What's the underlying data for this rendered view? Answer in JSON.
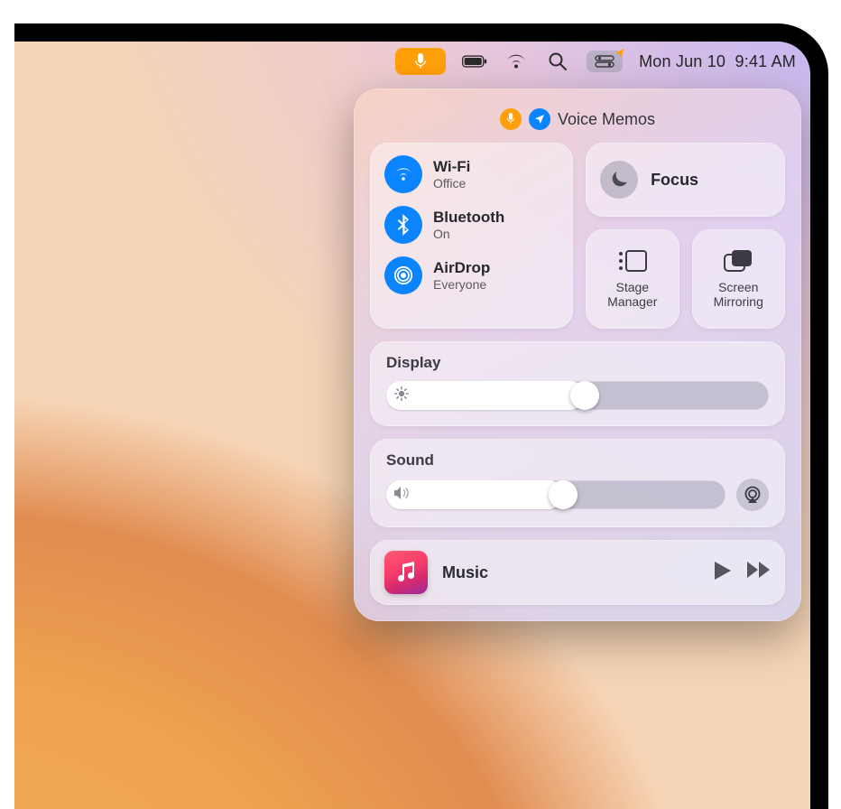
{
  "menubar": {
    "date": "Mon Jun 10",
    "time": "9:41 AM"
  },
  "cc_header": {
    "label": "Voice Memos"
  },
  "network": {
    "wifi": {
      "title": "Wi-Fi",
      "status": "Office"
    },
    "bluetooth": {
      "title": "Bluetooth",
      "status": "On"
    },
    "airdrop": {
      "title": "AirDrop",
      "status": "Everyone"
    }
  },
  "focus": {
    "label": "Focus"
  },
  "stage": {
    "label": "Stage\nManager"
  },
  "mirror": {
    "label": "Screen\nMirroring"
  },
  "display": {
    "label": "Display",
    "value_pct": 52
  },
  "sound": {
    "label": "Sound",
    "value_pct": 52
  },
  "music": {
    "label": "Music"
  }
}
